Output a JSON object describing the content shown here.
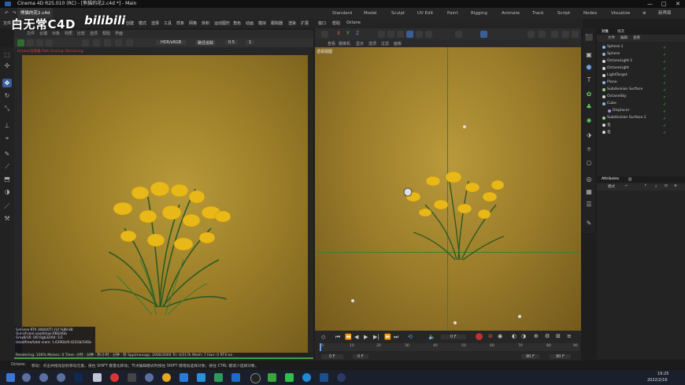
{
  "window": {
    "title": "Cinema 4D R25.010 (RC) - [熊猫的花2.c4d *] - Main"
  },
  "menu": {
    "file_tab": "熊猫的花2.c4d",
    "items": [
      "文件",
      "编辑",
      "创建",
      "模式",
      "选择",
      "工具",
      "样条",
      "网格",
      "体积",
      "运动图形",
      "角色",
      "动画",
      "模拟",
      "跟踪器",
      "渲染",
      "扩展",
      "窗口",
      "帮助",
      "Octane"
    ],
    "layouts": [
      "Standard",
      "Model",
      "Sculpt",
      "UV Edit",
      "Paint",
      "Rigging",
      "Animate",
      "Track",
      "Script",
      "Nodes",
      "Visualize"
    ],
    "new_layout": "新界面"
  },
  "watermark": {
    "text": "白无常C4D",
    "logo": "bilibili"
  },
  "left_viewport": {
    "title": "Octane Live Viewer",
    "menus": [
      "文件",
      "云端",
      "对象",
      "材质",
      "比较",
      "选项",
      "帮助",
      "界面"
    ],
    "resolution": "HDR/sRGB",
    "mode": "路径追踪",
    "value1": "0.5",
    "value2": "1",
    "hint": "Octane渲染器 Path tracing: Denoising",
    "stats": [
      "GeForce RTX 3080(DT) [U]  %88  88",
      "Out-of-core used/max:0Kb/4Gb",
      "Grey8/16: 0/0        Rgb32/64: 1/1",
      "Used/free/total vram: 1.629Gb/9.422Gb/10Gb",
      "Rendering: 100%  Ms/sec: 0  Time: 小时 : 分钟 : 秒/小时 : 分钟 : 秒  Spp/maxspp: 2000/2000  Tri: 0/317k  Mesh: 7  Hair: 0  RTX:on"
    ]
  },
  "right_viewport": {
    "view_label": "透视视图",
    "menus": [
      "查看",
      "摄像机",
      "显示",
      "选项",
      "过滤",
      "面板"
    ],
    "axis_buttons": [
      "X",
      "Y",
      "Z"
    ],
    "grid_text": "网格间距 : 10000 cm"
  },
  "timeline": {
    "ticks": [
      "0",
      "10",
      "20",
      "30",
      "40",
      "50",
      "60",
      "70",
      "80",
      "90"
    ],
    "frame_current": "0 F",
    "start": "0 F",
    "start2": "0 F",
    "end": "90 F",
    "end2": "90 F"
  },
  "objects_panel": {
    "tabs": [
      "对象",
      "场次"
    ],
    "menus": [
      "文件",
      "编辑",
      "查看"
    ],
    "items": [
      {
        "name": "Sphere.1",
        "color": "#8cb4e8"
      },
      {
        "name": "Sphere",
        "color": "#8cb4e8"
      },
      {
        "name": "OctaneLight.1",
        "color": "#d8d8d8"
      },
      {
        "name": "OctaneLight",
        "color": "#d8d8d8"
      },
      {
        "name": "LightTarget",
        "color": "#d8d8d8"
      },
      {
        "name": "Plane",
        "color": "#8cb4e8"
      },
      {
        "name": "Subdivision Surface",
        "color": "#9ad08a"
      },
      {
        "name": "OctaneSky",
        "color": "#d8d8d8"
      },
      {
        "name": "Cube",
        "color": "#8cb4e8"
      },
      {
        "name": "Displacer",
        "color": "#b28ad8"
      },
      {
        "name": "Subdivision Surface.1",
        "color": "#9ad08a"
      },
      {
        "name": "花",
        "color": "#d8d8d8"
      },
      {
        "name": "花",
        "color": "#d8d8d8"
      }
    ]
  },
  "attributes_panel": {
    "tabs": [
      "Attributes",
      "层"
    ],
    "menu": "模式"
  },
  "status_bar": {
    "label": "Octane:",
    "text": "移动：点击并拖动鼠标移动元素。按住 SHIFT 键量化移动；节点编辑模式时按住 SHIFT 键增加选择对象；按住 CTRL 键减少选择对象。"
  },
  "taskbar": {
    "time": "19:25",
    "date": "2022/2/16"
  }
}
